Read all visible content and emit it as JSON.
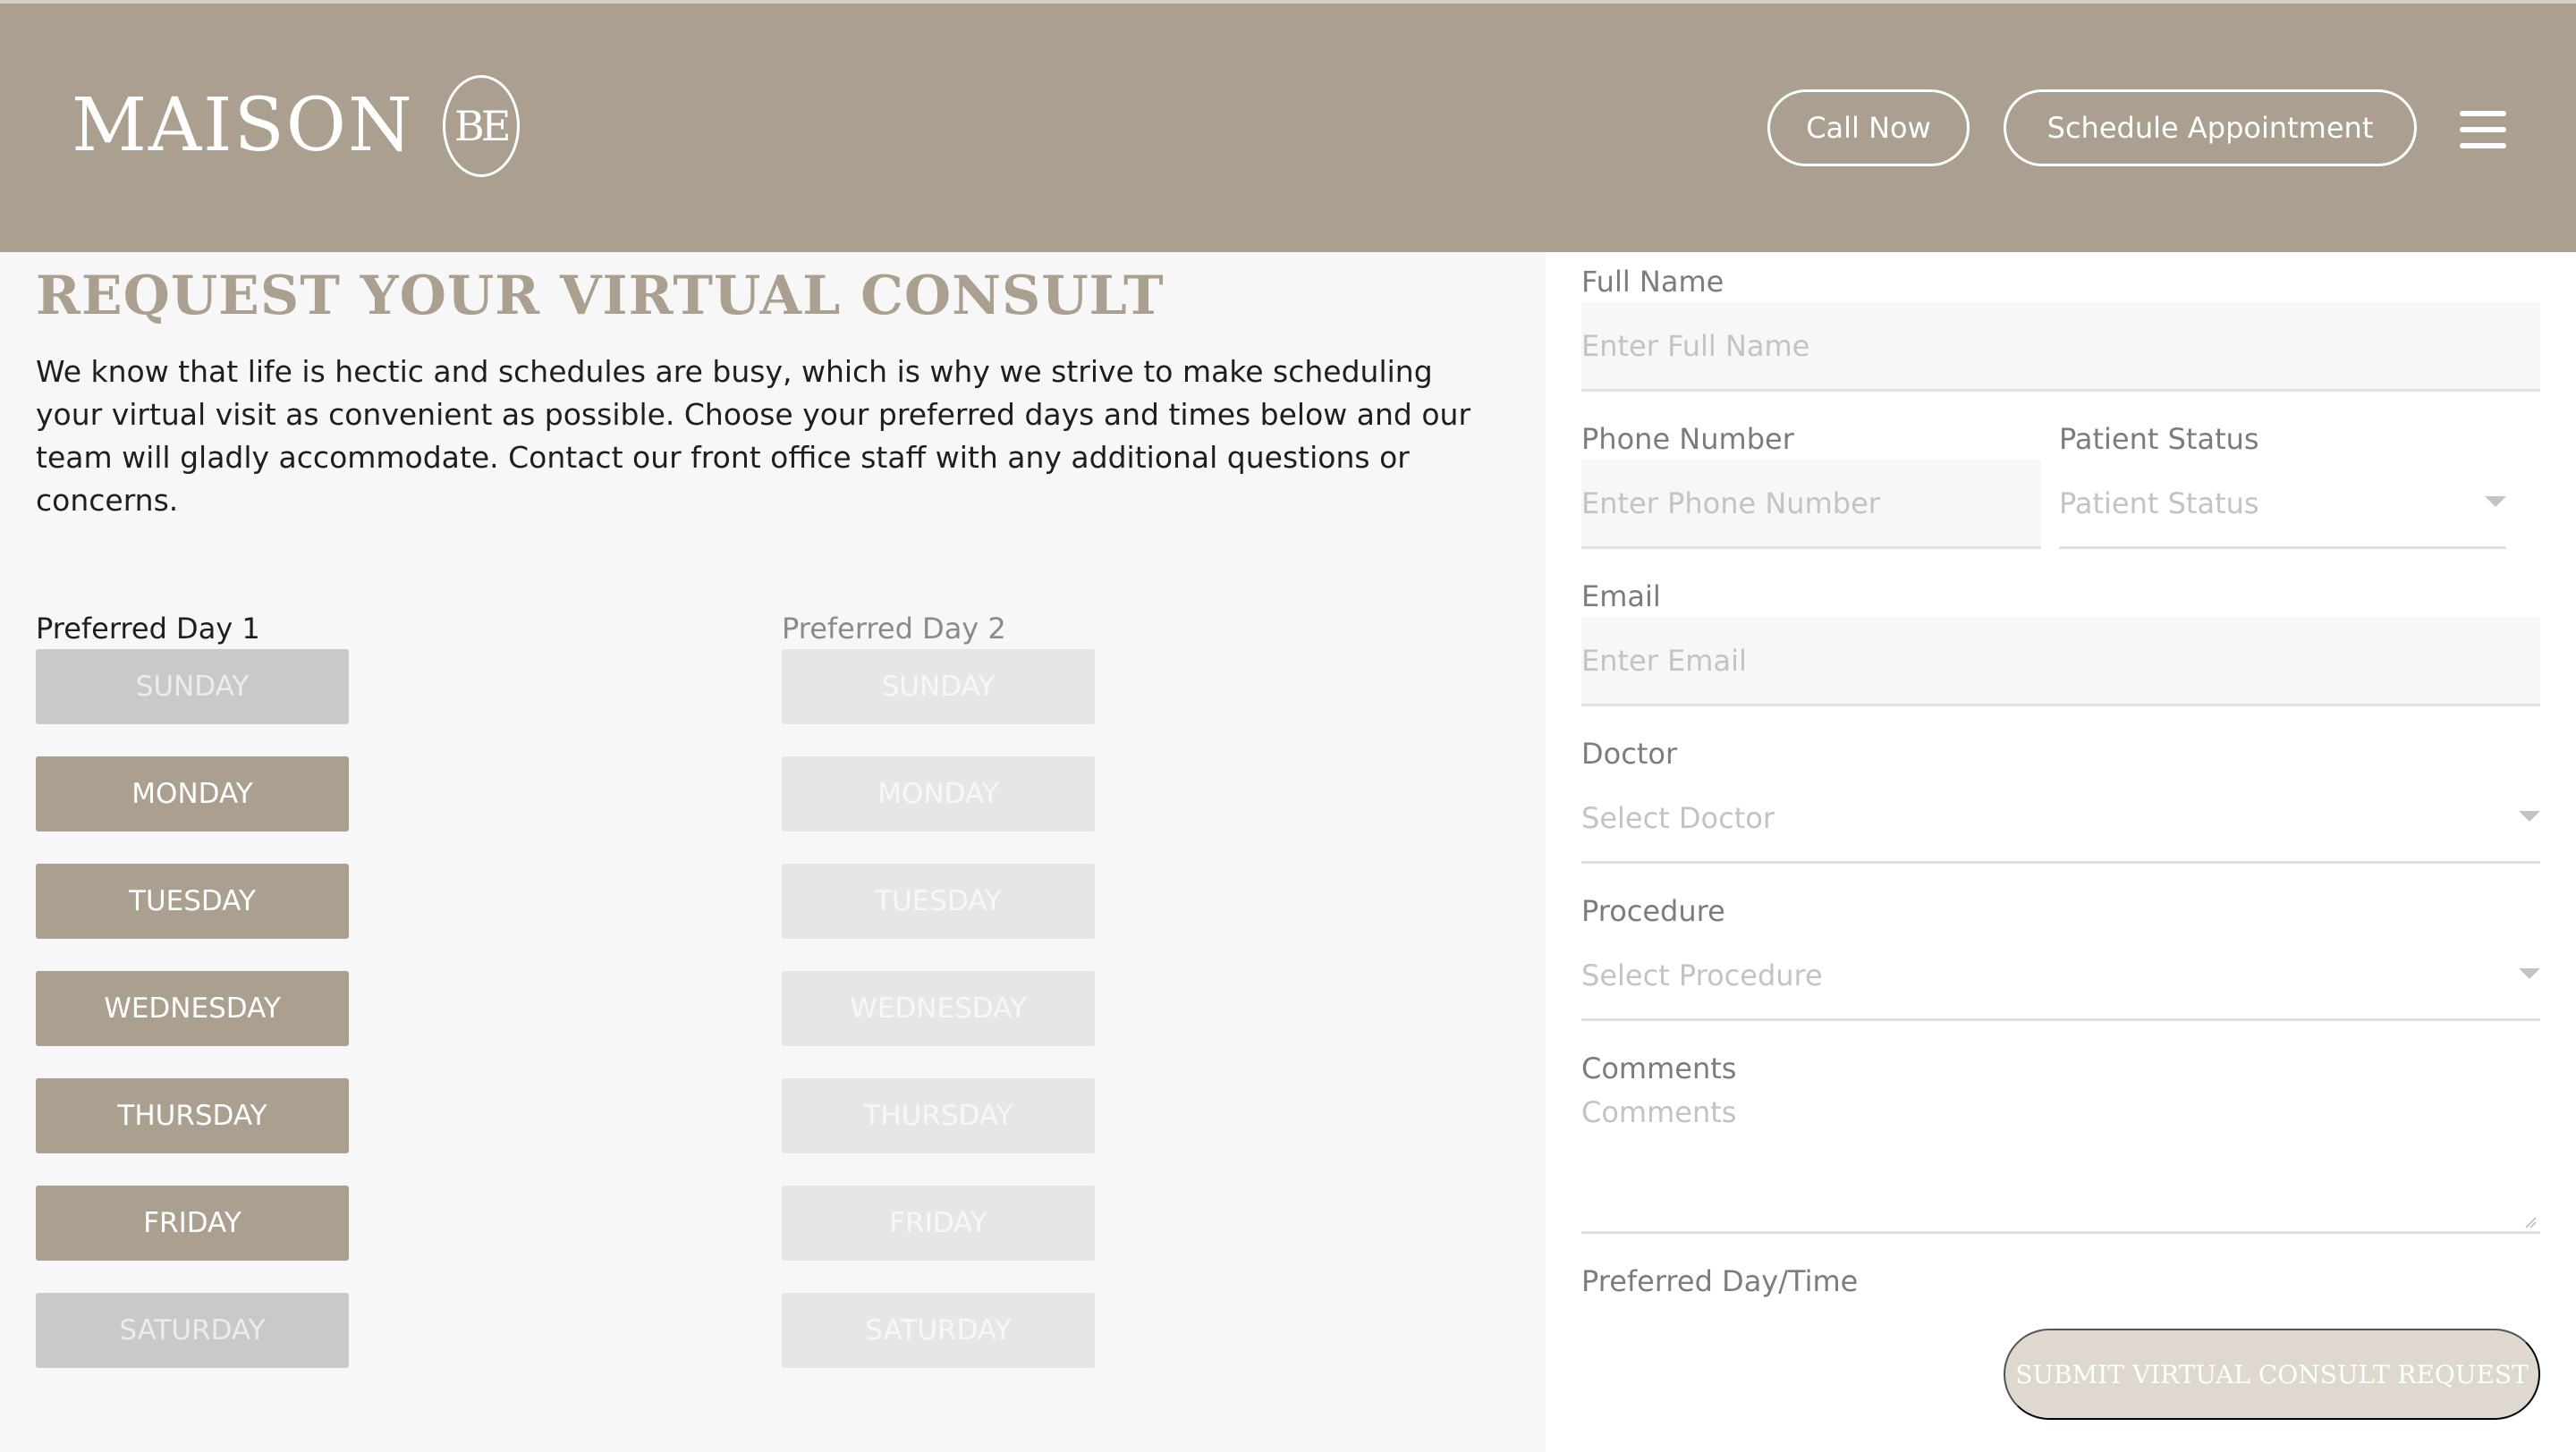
{
  "brand": {
    "name": "MAISON",
    "monogram": "BE"
  },
  "header": {
    "call_label": "Call Now",
    "schedule_label": "Schedule Appointment",
    "menu_icon": "hamburger-menu-icon"
  },
  "main": {
    "title": "REQUEST YOUR VIRTUAL CONSULT",
    "intro": "We know that life is hectic and schedules are busy, which is why we strive to make scheduling your virtual visit as convenient as possible. Choose your preferred days and times below and our team will gladly accommodate. Contact our front office staff with any additional questions or concerns."
  },
  "day1": {
    "label": "Preferred Day 1",
    "days": [
      {
        "label": "SUNDAY",
        "selected": false
      },
      {
        "label": "MONDAY",
        "selected": true
      },
      {
        "label": "TUESDAY",
        "selected": true
      },
      {
        "label": "WEDNESDAY",
        "selected": true
      },
      {
        "label": "THURSDAY",
        "selected": true
      },
      {
        "label": "FRIDAY",
        "selected": true
      },
      {
        "label": "SATURDAY",
        "selected": false
      }
    ]
  },
  "day2": {
    "label": "Preferred Day 2",
    "days": [
      {
        "label": "SUNDAY",
        "selected": false
      },
      {
        "label": "MONDAY",
        "selected": false
      },
      {
        "label": "TUESDAY",
        "selected": false
      },
      {
        "label": "WEDNESDAY",
        "selected": false
      },
      {
        "label": "THURSDAY",
        "selected": false
      },
      {
        "label": "FRIDAY",
        "selected": false
      },
      {
        "label": "SATURDAY",
        "selected": false
      }
    ]
  },
  "form": {
    "full_name": {
      "label": "Full Name",
      "placeholder": "Enter Full Name",
      "value": ""
    },
    "phone": {
      "label": "Phone Number",
      "placeholder": "Enter Phone Number",
      "value": ""
    },
    "patient_status": {
      "label": "Patient Status",
      "placeholder": "Patient Status"
    },
    "email": {
      "label": "Email",
      "placeholder": "Enter Email",
      "value": ""
    },
    "doctor": {
      "label": "Doctor",
      "placeholder": "Select Doctor"
    },
    "procedure": {
      "label": "Procedure",
      "placeholder": "Select Procedure"
    },
    "comments": {
      "label": "Comments",
      "placeholder": "Comments",
      "value": ""
    },
    "preferred_daytime_label": "Preferred Day/Time",
    "submit_label": "SUBMIT VIRTUAL CONSULT REQUEST"
  },
  "colors": {
    "brand": "#ab9f8f",
    "button_off": "#c9c9c9",
    "button_disabled": "#e6e6e6",
    "submit": "#ded8d0"
  }
}
